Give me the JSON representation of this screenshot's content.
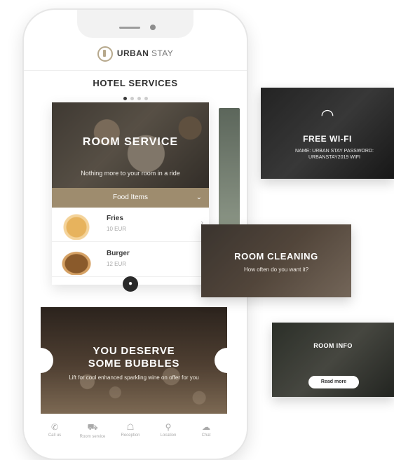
{
  "brand": {
    "name_bold": "URBAN",
    "name_light": "STAY",
    "logo_icon": "logo-icon"
  },
  "header": {
    "title": "HOTEL SERVICES",
    "carousel_dots": 4,
    "active_dot": 0
  },
  "room_service": {
    "title": "ROOM SERVICE",
    "subtitle": "Nothing more to your room in a ride",
    "dropdown_label": "Food Items",
    "items": [
      {
        "name": "Fries",
        "price": "10 EUR",
        "image_icon": "fries-thumbnail"
      },
      {
        "name": "Burger",
        "price": "12 EUR",
        "image_icon": "burger-thumbnail"
      }
    ]
  },
  "ticket": {
    "title_line1": "YOU DESERVE",
    "title_line2": "SOME BUBBLES",
    "subtitle": "Lift for cool enhanced sparkling wine on offer for you"
  },
  "nav": {
    "items": [
      {
        "label": "Call us",
        "icon": "phone-icon"
      },
      {
        "label": "Room service",
        "icon": "cart-icon"
      },
      {
        "label": "Reception",
        "icon": "bell-icon"
      },
      {
        "label": "Location",
        "icon": "pin-icon"
      },
      {
        "label": "Chat",
        "icon": "chat-icon"
      }
    ]
  },
  "cards": {
    "wifi": {
      "title": "FREE WI-FI",
      "subtitle": "NAME: URBAN STAY PASSWORD: URBANSTAY2019 WIFI",
      "icon": "wifi-icon"
    },
    "cleaning": {
      "title": "ROOM CLEANING",
      "subtitle": "How often do you want it?"
    },
    "info": {
      "title": "ROOM INFO",
      "button_label": "Read more"
    }
  },
  "colors": {
    "accent": "#9e8c6e",
    "dark": "#2a2a2a",
    "logo": "#b6a88c"
  }
}
